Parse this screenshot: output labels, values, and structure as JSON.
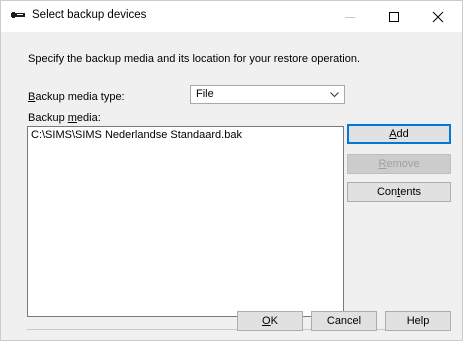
{
  "window": {
    "title": "Select backup devices"
  },
  "instructions": "Specify the backup media and its location for your restore operation.",
  "backup_media_type": {
    "label_ul": "B",
    "label_rest": "ackup media type:",
    "selected": "File"
  },
  "backup_media": {
    "label_pre": "Backup ",
    "label_ul": "m",
    "label_rest": "edia:",
    "items": [
      "C:\\SIMS\\SIMS Nederlandse Standaard.bak"
    ]
  },
  "buttons": {
    "add": {
      "ul": "A",
      "rest": "dd"
    },
    "remove": {
      "ul": "R",
      "rest": "emove"
    },
    "contents": {
      "pre": "Con",
      "ul": "t",
      "rest": "ents"
    },
    "ok": {
      "ul": "O",
      "rest": "K"
    },
    "cancel": "Cancel",
    "help": "Help"
  },
  "colors": {
    "accent": "#0078d7",
    "dialog_bg": "#f0f0f0",
    "disabled_text": "#a0a0a0"
  }
}
